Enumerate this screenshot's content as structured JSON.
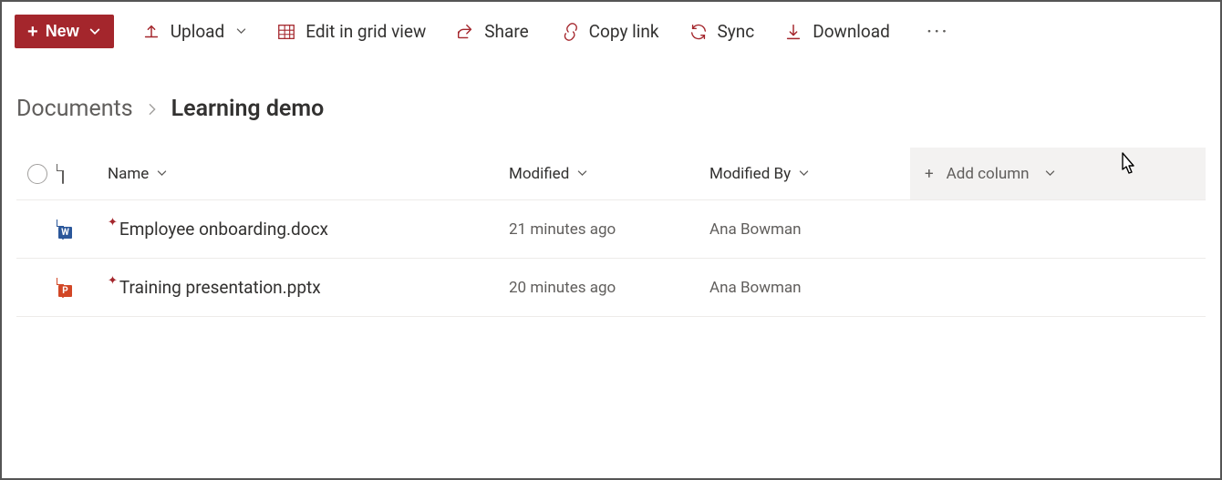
{
  "toolbar": {
    "new_label": "New",
    "upload_label": "Upload",
    "edit_grid_label": "Edit in grid view",
    "share_label": "Share",
    "copy_link_label": "Copy link",
    "sync_label": "Sync",
    "download_label": "Download"
  },
  "breadcrumb": {
    "root": "Documents",
    "current": "Learning demo"
  },
  "columns": {
    "name": "Name",
    "modified": "Modified",
    "modified_by": "Modified By",
    "add_column": "Add column"
  },
  "files": [
    {
      "icon": "word",
      "name": "Employee onboarding.docx",
      "modified": "21 minutes ago",
      "modified_by": "Ana Bowman",
      "is_new": true
    },
    {
      "icon": "ppt",
      "name": "Training presentation.pptx",
      "modified": "20 minutes ago",
      "modified_by": "Ana Bowman",
      "is_new": true
    }
  ]
}
